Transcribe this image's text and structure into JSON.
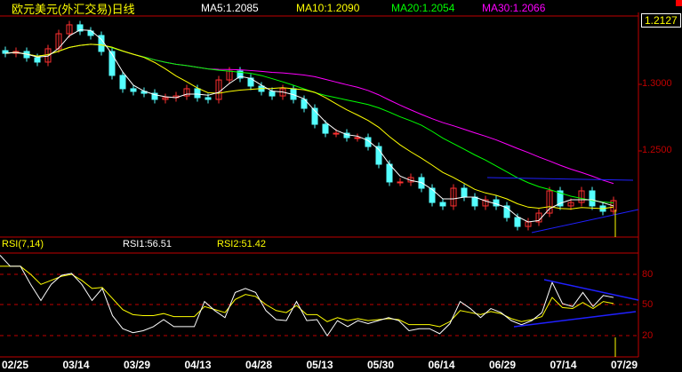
{
  "header": {
    "title": "欧元美元(外汇交易)日线",
    "ma5": "MA5:1.2085",
    "ma10": "MA10:1.2090",
    "ma20": "MA20:1.2054",
    "ma30": "MA30:1.2066"
  },
  "price_axis": {
    "current": "1.2127",
    "ticks": [
      "1.3000",
      "1.2500"
    ]
  },
  "rsi_header": {
    "name": "RSI(7,14)",
    "rsi1": "RSI1:56.51",
    "rsi2": "RSI2:51.42"
  },
  "rsi_axis": {
    "ticks": [
      "80",
      "50",
      "20"
    ]
  },
  "dates": [
    "02/25",
    "03/14",
    "03/29",
    "04/13",
    "04/28",
    "05/13",
    "05/30",
    "06/14",
    "06/29",
    "07/14",
    "07/29"
  ],
  "colors": {
    "up": "#ff3030",
    "down": "#54ffff",
    "ma5": "#ffffff",
    "ma10": "#ffff00",
    "ma20": "#00ff00",
    "ma30": "#ff00ff",
    "grid": "#c00000",
    "trend": "#2020ff"
  },
  "chart_data": {
    "type": "candlestick",
    "closes": [
      1.3233,
      1.3247,
      1.32,
      1.3167,
      1.3267,
      1.338,
      1.3447,
      1.34,
      1.3367,
      1.3247,
      1.3067,
      1.2967,
      1.2947,
      1.2933,
      1.2887,
      1.29,
      1.2913,
      1.2967,
      1.29,
      1.2887,
      1.3033,
      1.31,
      1.3047,
      1.2987,
      1.2947,
      1.2913,
      1.2967,
      1.2887,
      1.282,
      1.27,
      1.2633,
      1.2633,
      1.26,
      1.26,
      1.2533,
      1.24,
      1.2267,
      1.2267,
      1.23,
      1.222,
      1.2113,
      1.2087,
      1.222,
      1.2153,
      1.2087,
      1.2133,
      1.2087,
      1.2,
      1.1933,
      1.1967,
      1.2033,
      1.22,
      1.2087,
      1.2113,
      1.22,
      1.2087,
      1.2047,
      1.2127
    ],
    "rsi1": [
      99,
      88,
      88,
      70,
      54,
      70,
      79,
      81,
      70,
      54,
      66,
      39,
      26,
      22,
      24,
      28,
      35,
      28,
      28,
      28,
      53,
      44,
      37,
      62,
      66,
      62,
      44,
      35,
      34,
      53,
      34,
      35,
      19,
      34,
      28,
      34,
      31,
      34,
      37,
      34,
      24,
      26,
      26,
      21,
      31,
      53,
      46,
      37,
      46,
      42,
      34,
      30,
      34,
      42,
      72,
      51,
      48,
      62,
      48,
      59,
      57
    ],
    "rsi2": [
      88,
      88,
      88,
      80,
      70,
      74,
      78,
      80,
      74,
      66,
      67,
      56,
      45,
      40,
      39,
      39,
      41,
      38,
      38,
      38,
      48,
      45,
      42,
      55,
      60,
      58,
      50,
      44,
      42,
      49,
      40,
      40,
      33,
      37,
      34,
      36,
      34,
      35,
      36,
      35,
      30,
      30,
      30,
      28,
      33,
      44,
      42,
      40,
      43,
      41,
      36,
      33,
      35,
      38,
      57,
      47,
      46,
      52,
      46,
      53,
      51
    ],
    "ylim_price": [
      1.188,
      1.35
    ],
    "ylim_rsi": [
      0,
      100
    ]
  }
}
